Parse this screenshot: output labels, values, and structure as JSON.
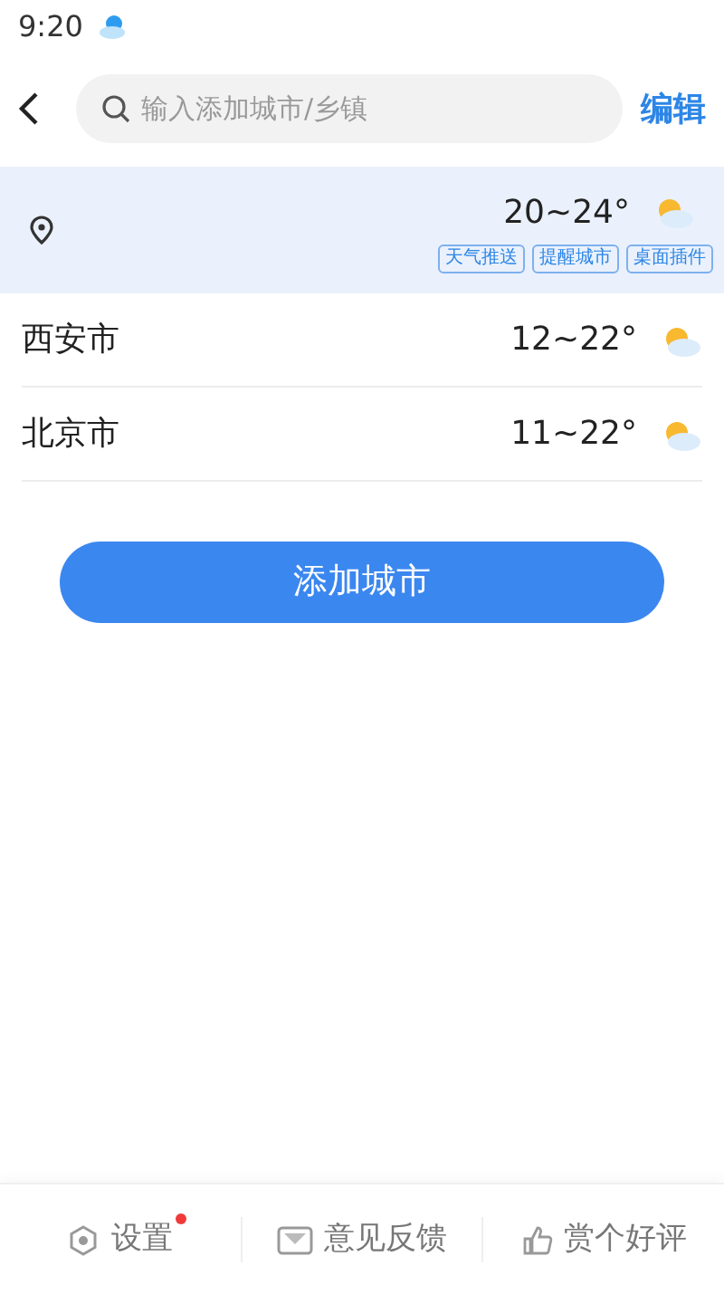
{
  "status_bar": {
    "time": "9:20"
  },
  "header": {
    "search": {
      "placeholder": "输入添加城市/乡镇"
    },
    "edit": "编辑"
  },
  "current_location": {
    "temp": "20~24°",
    "tags": [
      "天气推送",
      "提醒城市",
      "桌面插件"
    ]
  },
  "cities": [
    {
      "name": "西安市",
      "temp": "12~22°"
    },
    {
      "name": "北京市",
      "temp": "11~22°"
    }
  ],
  "add_button": "添加城市",
  "footer": [
    {
      "kind": "settings",
      "label": "设置",
      "badge": true
    },
    {
      "kind": "feedback",
      "label": "意见反馈",
      "badge": false
    },
    {
      "kind": "rate",
      "label": "赏个好评",
      "badge": false
    }
  ]
}
